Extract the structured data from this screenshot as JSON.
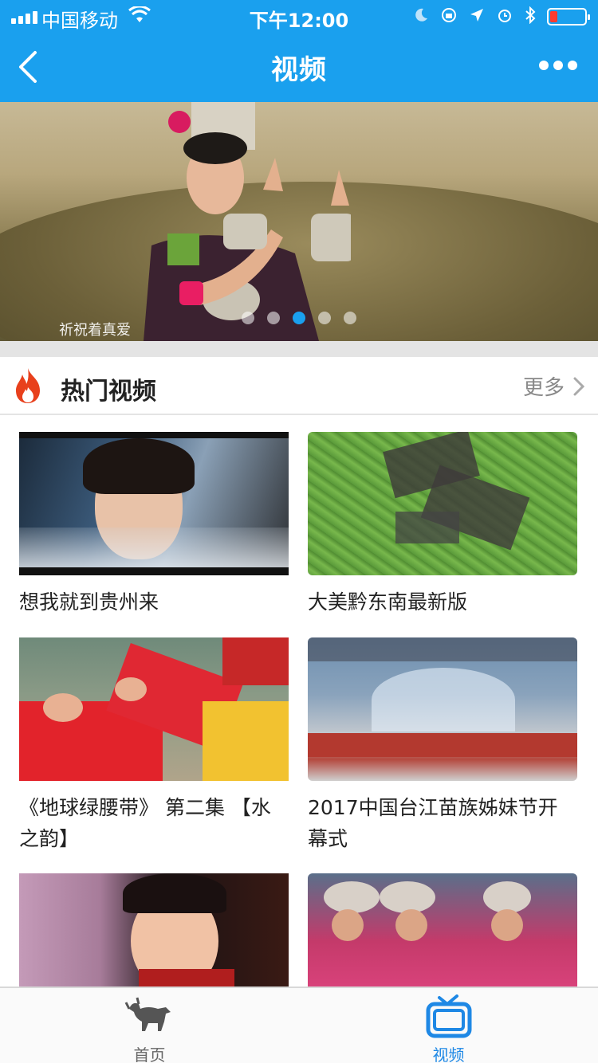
{
  "status_bar": {
    "carrier": "中国移动",
    "time": "下午12:00"
  },
  "nav": {
    "title": "视频"
  },
  "banner": {
    "caption": "祈祝着真爱",
    "dot_count": 5,
    "active_dot": 3
  },
  "section": {
    "title": "热门视频",
    "more_label": "更多"
  },
  "videos": [
    {
      "title": "想我就到贵州来"
    },
    {
      "title": "大美黔东南最新版"
    },
    {
      "title": "《地球绿腰带》 第二集 【水之韵】"
    },
    {
      "title": "2017中国台江苗族姊妹节开幕式"
    },
    {
      "title": ""
    },
    {
      "title": ""
    }
  ],
  "tabbar": {
    "items": [
      {
        "label": "首页"
      },
      {
        "label": "视频"
      }
    ],
    "active": 1
  },
  "colors": {
    "accent": "#1aa0ee",
    "tab_active": "#1e88e5",
    "fire": "#e8401c"
  }
}
